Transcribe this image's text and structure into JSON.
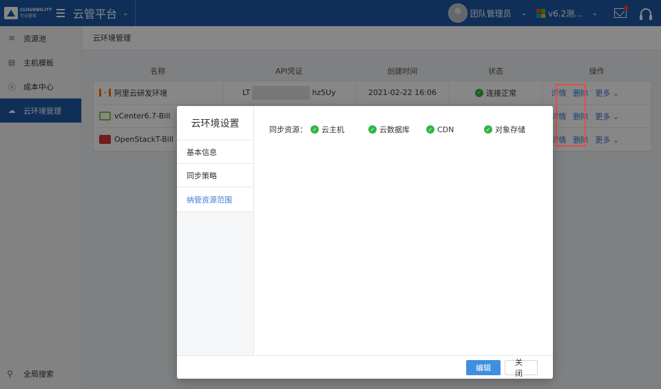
{
  "brand": {
    "logo_line1": "CLOUDBILITY",
    "logo_line2": "行云管家",
    "platform": "云管平台"
  },
  "header": {
    "user": "团队管理员",
    "version": "v6.2测..."
  },
  "sidebar": {
    "items": [
      {
        "label": "资源池",
        "icon": "layers-icon"
      },
      {
        "label": "主机模板",
        "icon": "template-icon"
      },
      {
        "label": "成本中心",
        "icon": "dollar-icon"
      },
      {
        "label": "云环境管理",
        "icon": "cloud-settings-icon",
        "active": true
      }
    ],
    "bottom": "全局搜索"
  },
  "breadcrumb": "云环境管理",
  "table": {
    "headers": [
      "名称",
      "API凭证",
      "创建时间",
      "状态",
      "操作"
    ],
    "rows": [
      {
        "name": "阿里云研发环境",
        "credential_prefix": "LT",
        "credential_suffix": "hz5Uy",
        "created": "2021-02-22 16:06",
        "status": "连接正常"
      },
      {
        "name": "vCenter6.7-Bill"
      },
      {
        "name": "OpenStackT-Bill"
      }
    ],
    "ops": {
      "detail": "详情",
      "delete": "删除",
      "more": "更多"
    }
  },
  "modal": {
    "title": "云环境设置",
    "tabs": [
      "基本信息",
      "同步策略",
      "纳管资源范围"
    ],
    "active_tab": 2,
    "sync_label": "同步资源：",
    "sync_items": [
      "云主机",
      "云数据库",
      "CDN",
      "对象存储"
    ],
    "buttons": {
      "edit": "编辑",
      "close": "关闭"
    }
  },
  "colors": {
    "primary": "#1d5aa6",
    "link": "#3a7bd5",
    "success": "#2fb544",
    "highlight": "#e84a4a"
  }
}
